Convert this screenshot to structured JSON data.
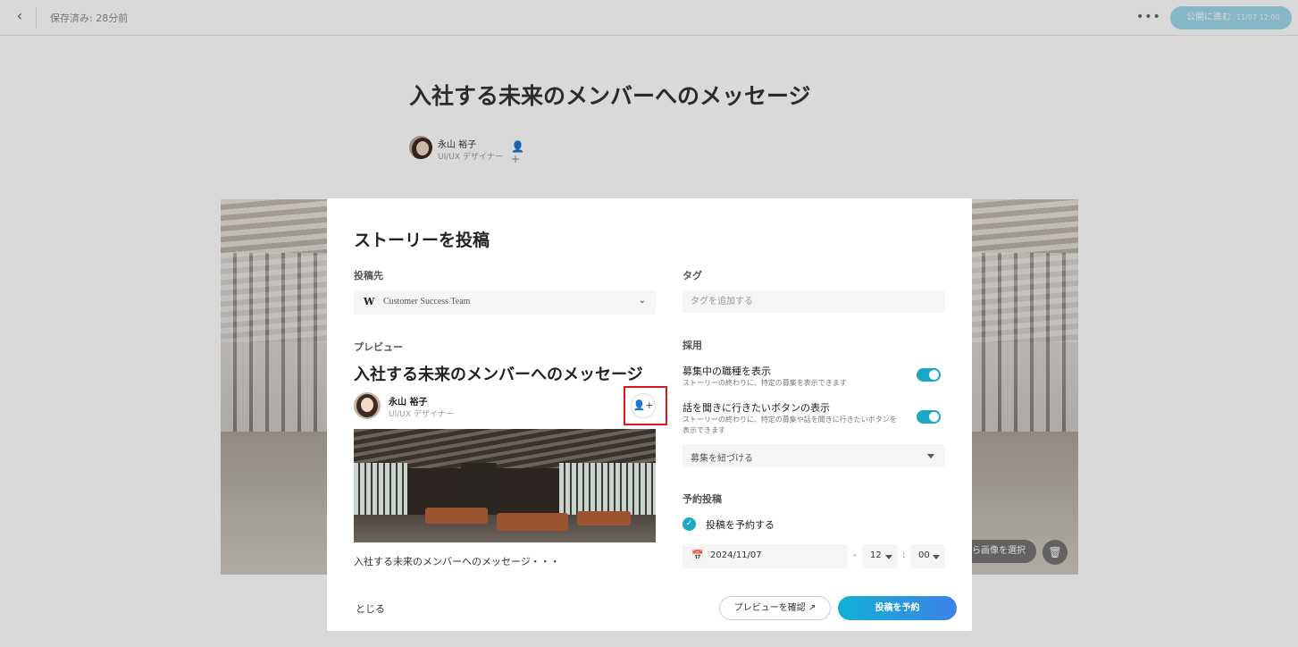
{
  "topbar": {
    "saved_status": "保存済み: 28分前",
    "more_icon": "ellipsis-icon",
    "publish_label": "公開に進む",
    "publish_date": "11/07 12:00"
  },
  "editor": {
    "title": "入社する未来のメンバーへのメッセージ",
    "author_name": "永山 裕子",
    "author_role": "UI/UX デザイナー",
    "cover_select_label": "ら画像を選択"
  },
  "modal": {
    "title": "ストーリーを投稿",
    "destination": {
      "label": "投稿先",
      "value": "Customer Success Team",
      "logo_text": "W"
    },
    "preview": {
      "label": "プレビュー",
      "title": "入社する未来のメンバーへのメッセージ",
      "author_name": "永山 裕子",
      "author_role": "UI/UX デザイナー",
      "excerpt": "入社する未来のメンバーへのメッセージ・・・"
    },
    "tags": {
      "label": "タグ",
      "placeholder": "タグを追加する"
    },
    "recruitment": {
      "label": "採用",
      "option1_title": "募集中の職種を表示",
      "option1_desc": "ストーリーの終わりに、特定の募集を表示できます",
      "option1_on": true,
      "option2_title": "話を聞きに行きたいボタンの表示",
      "option2_desc": "ストーリーの終わりに、特定の募集や話を聞きに行きたいボタンを表示できます",
      "option2_on": true,
      "link_select": "募集を紐づける"
    },
    "schedule": {
      "label": "予約投稿",
      "checkbox_label": "投稿を予約する",
      "checked": true,
      "date": "2024/11/07",
      "hour": "12",
      "minute": "00"
    },
    "footer": {
      "close": "とじる",
      "preview_button": "プレビューを確認",
      "submit_button": "投稿を予約"
    }
  },
  "colors": {
    "accent": "#1aa9c4",
    "highlight": "#e0161b",
    "overlay": "rgba(0,0,0,0.15)"
  }
}
